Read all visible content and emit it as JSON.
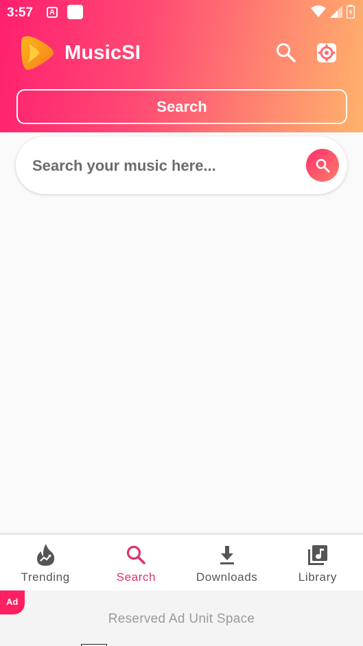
{
  "status_bar": {
    "time": "3:57",
    "notification_icon": "A"
  },
  "header": {
    "app_name": "MusicSI",
    "tab_title": "Search",
    "icons": {
      "search": "search-icon",
      "settings": "settings-icon"
    }
  },
  "search": {
    "placeholder": "Search your music here..."
  },
  "bottom_nav": {
    "items": [
      {
        "label": "Trending",
        "icon": "flame-trending-icon",
        "active": false
      },
      {
        "label": "Search",
        "icon": "search-icon",
        "active": true
      },
      {
        "label": "Downloads",
        "icon": "download-icon",
        "active": false
      },
      {
        "label": "Library",
        "icon": "library-music-icon",
        "active": false
      }
    ]
  },
  "ad": {
    "badge": "Ad",
    "text": "Reserved Ad Unit Space"
  },
  "colors": {
    "gradient_start": "#ff1f6e",
    "gradient_end": "#ffb26b",
    "accent": "#e0306b"
  }
}
